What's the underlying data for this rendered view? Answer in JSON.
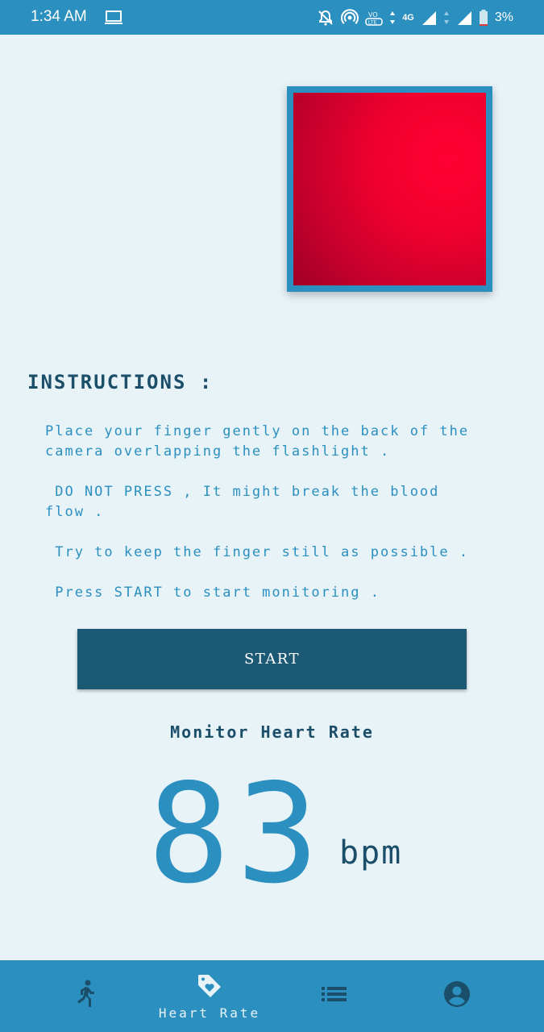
{
  "status_bar": {
    "time": "1:34 AM",
    "network_label": "4G",
    "battery": "3%",
    "icons": [
      "laptop-icon",
      "bell-off-icon",
      "hotspot-icon",
      "volte-icon",
      "signal-icon",
      "battery-icon"
    ]
  },
  "camera": {
    "frame_color": "#2b8fbf",
    "preview_color": "#ff0033"
  },
  "instructions": {
    "title": "INSTRUCTIONS :",
    "items": [
      "Place your finger gently on the back of the\ncamera overlapping the flashlight .",
      " DO NOT PRESS , It might break the blood\nflow .",
      " Try to keep the finger still as possible .",
      " Press START to start monitoring ."
    ]
  },
  "start_button": {
    "label": "START"
  },
  "monitor": {
    "title": "Monitor Heart Rate",
    "value": "83",
    "unit": "bpm"
  },
  "bottom_nav": {
    "items": [
      {
        "icon": "running-icon",
        "label": ""
      },
      {
        "icon": "heart-tag-icon",
        "label": "Heart Rate"
      },
      {
        "icon": "list-icon",
        "label": ""
      },
      {
        "icon": "account-icon",
        "label": ""
      }
    ],
    "active": "Heart Rate"
  },
  "colors": {
    "primary": "#2b8fbf",
    "dark": "#1b5975",
    "background": "#e8f3f8"
  }
}
